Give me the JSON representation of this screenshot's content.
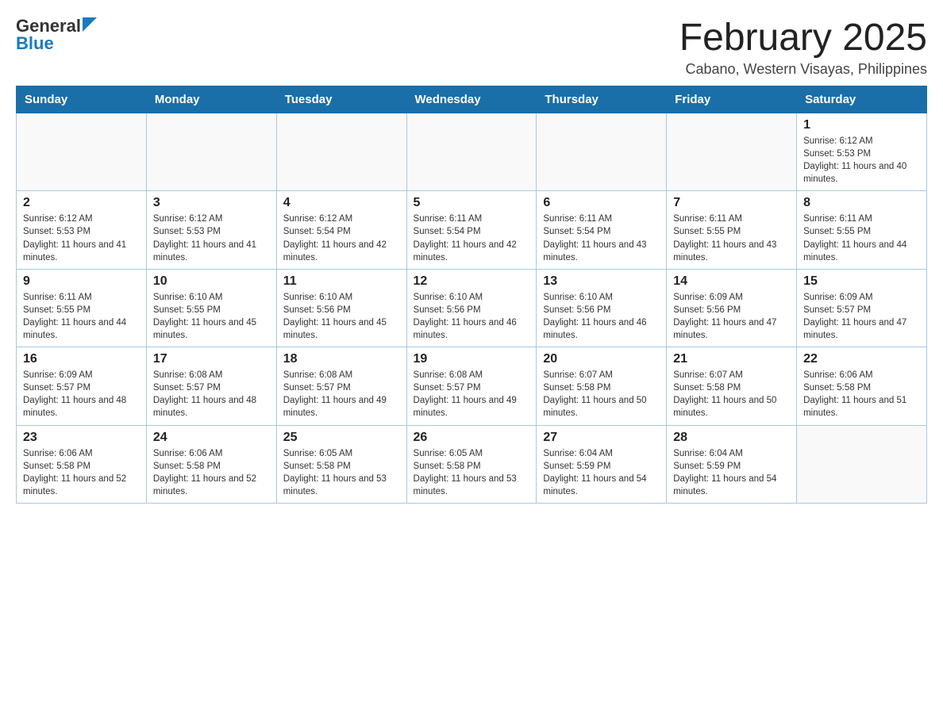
{
  "header": {
    "logo_general": "General",
    "logo_blue": "Blue",
    "month_title": "February 2025",
    "location": "Cabano, Western Visayas, Philippines"
  },
  "weekdays": [
    "Sunday",
    "Monday",
    "Tuesday",
    "Wednesday",
    "Thursday",
    "Friday",
    "Saturday"
  ],
  "weeks": [
    [
      {
        "day": "",
        "sunrise": "",
        "sunset": "",
        "daylight": ""
      },
      {
        "day": "",
        "sunrise": "",
        "sunset": "",
        "daylight": ""
      },
      {
        "day": "",
        "sunrise": "",
        "sunset": "",
        "daylight": ""
      },
      {
        "day": "",
        "sunrise": "",
        "sunset": "",
        "daylight": ""
      },
      {
        "day": "",
        "sunrise": "",
        "sunset": "",
        "daylight": ""
      },
      {
        "day": "",
        "sunrise": "",
        "sunset": "",
        "daylight": ""
      },
      {
        "day": "1",
        "sunrise": "Sunrise: 6:12 AM",
        "sunset": "Sunset: 5:53 PM",
        "daylight": "Daylight: 11 hours and 40 minutes."
      }
    ],
    [
      {
        "day": "2",
        "sunrise": "Sunrise: 6:12 AM",
        "sunset": "Sunset: 5:53 PM",
        "daylight": "Daylight: 11 hours and 41 minutes."
      },
      {
        "day": "3",
        "sunrise": "Sunrise: 6:12 AM",
        "sunset": "Sunset: 5:53 PM",
        "daylight": "Daylight: 11 hours and 41 minutes."
      },
      {
        "day": "4",
        "sunrise": "Sunrise: 6:12 AM",
        "sunset": "Sunset: 5:54 PM",
        "daylight": "Daylight: 11 hours and 42 minutes."
      },
      {
        "day": "5",
        "sunrise": "Sunrise: 6:11 AM",
        "sunset": "Sunset: 5:54 PM",
        "daylight": "Daylight: 11 hours and 42 minutes."
      },
      {
        "day": "6",
        "sunrise": "Sunrise: 6:11 AM",
        "sunset": "Sunset: 5:54 PM",
        "daylight": "Daylight: 11 hours and 43 minutes."
      },
      {
        "day": "7",
        "sunrise": "Sunrise: 6:11 AM",
        "sunset": "Sunset: 5:55 PM",
        "daylight": "Daylight: 11 hours and 43 minutes."
      },
      {
        "day": "8",
        "sunrise": "Sunrise: 6:11 AM",
        "sunset": "Sunset: 5:55 PM",
        "daylight": "Daylight: 11 hours and 44 minutes."
      }
    ],
    [
      {
        "day": "9",
        "sunrise": "Sunrise: 6:11 AM",
        "sunset": "Sunset: 5:55 PM",
        "daylight": "Daylight: 11 hours and 44 minutes."
      },
      {
        "day": "10",
        "sunrise": "Sunrise: 6:10 AM",
        "sunset": "Sunset: 5:55 PM",
        "daylight": "Daylight: 11 hours and 45 minutes."
      },
      {
        "day": "11",
        "sunrise": "Sunrise: 6:10 AM",
        "sunset": "Sunset: 5:56 PM",
        "daylight": "Daylight: 11 hours and 45 minutes."
      },
      {
        "day": "12",
        "sunrise": "Sunrise: 6:10 AM",
        "sunset": "Sunset: 5:56 PM",
        "daylight": "Daylight: 11 hours and 46 minutes."
      },
      {
        "day": "13",
        "sunrise": "Sunrise: 6:10 AM",
        "sunset": "Sunset: 5:56 PM",
        "daylight": "Daylight: 11 hours and 46 minutes."
      },
      {
        "day": "14",
        "sunrise": "Sunrise: 6:09 AM",
        "sunset": "Sunset: 5:56 PM",
        "daylight": "Daylight: 11 hours and 47 minutes."
      },
      {
        "day": "15",
        "sunrise": "Sunrise: 6:09 AM",
        "sunset": "Sunset: 5:57 PM",
        "daylight": "Daylight: 11 hours and 47 minutes."
      }
    ],
    [
      {
        "day": "16",
        "sunrise": "Sunrise: 6:09 AM",
        "sunset": "Sunset: 5:57 PM",
        "daylight": "Daylight: 11 hours and 48 minutes."
      },
      {
        "day": "17",
        "sunrise": "Sunrise: 6:08 AM",
        "sunset": "Sunset: 5:57 PM",
        "daylight": "Daylight: 11 hours and 48 minutes."
      },
      {
        "day": "18",
        "sunrise": "Sunrise: 6:08 AM",
        "sunset": "Sunset: 5:57 PM",
        "daylight": "Daylight: 11 hours and 49 minutes."
      },
      {
        "day": "19",
        "sunrise": "Sunrise: 6:08 AM",
        "sunset": "Sunset: 5:57 PM",
        "daylight": "Daylight: 11 hours and 49 minutes."
      },
      {
        "day": "20",
        "sunrise": "Sunrise: 6:07 AM",
        "sunset": "Sunset: 5:58 PM",
        "daylight": "Daylight: 11 hours and 50 minutes."
      },
      {
        "day": "21",
        "sunrise": "Sunrise: 6:07 AM",
        "sunset": "Sunset: 5:58 PM",
        "daylight": "Daylight: 11 hours and 50 minutes."
      },
      {
        "day": "22",
        "sunrise": "Sunrise: 6:06 AM",
        "sunset": "Sunset: 5:58 PM",
        "daylight": "Daylight: 11 hours and 51 minutes."
      }
    ],
    [
      {
        "day": "23",
        "sunrise": "Sunrise: 6:06 AM",
        "sunset": "Sunset: 5:58 PM",
        "daylight": "Daylight: 11 hours and 52 minutes."
      },
      {
        "day": "24",
        "sunrise": "Sunrise: 6:06 AM",
        "sunset": "Sunset: 5:58 PM",
        "daylight": "Daylight: 11 hours and 52 minutes."
      },
      {
        "day": "25",
        "sunrise": "Sunrise: 6:05 AM",
        "sunset": "Sunset: 5:58 PM",
        "daylight": "Daylight: 11 hours and 53 minutes."
      },
      {
        "day": "26",
        "sunrise": "Sunrise: 6:05 AM",
        "sunset": "Sunset: 5:58 PM",
        "daylight": "Daylight: 11 hours and 53 minutes."
      },
      {
        "day": "27",
        "sunrise": "Sunrise: 6:04 AM",
        "sunset": "Sunset: 5:59 PM",
        "daylight": "Daylight: 11 hours and 54 minutes."
      },
      {
        "day": "28",
        "sunrise": "Sunrise: 6:04 AM",
        "sunset": "Sunset: 5:59 PM",
        "daylight": "Daylight: 11 hours and 54 minutes."
      },
      {
        "day": "",
        "sunrise": "",
        "sunset": "",
        "daylight": ""
      }
    ]
  ]
}
